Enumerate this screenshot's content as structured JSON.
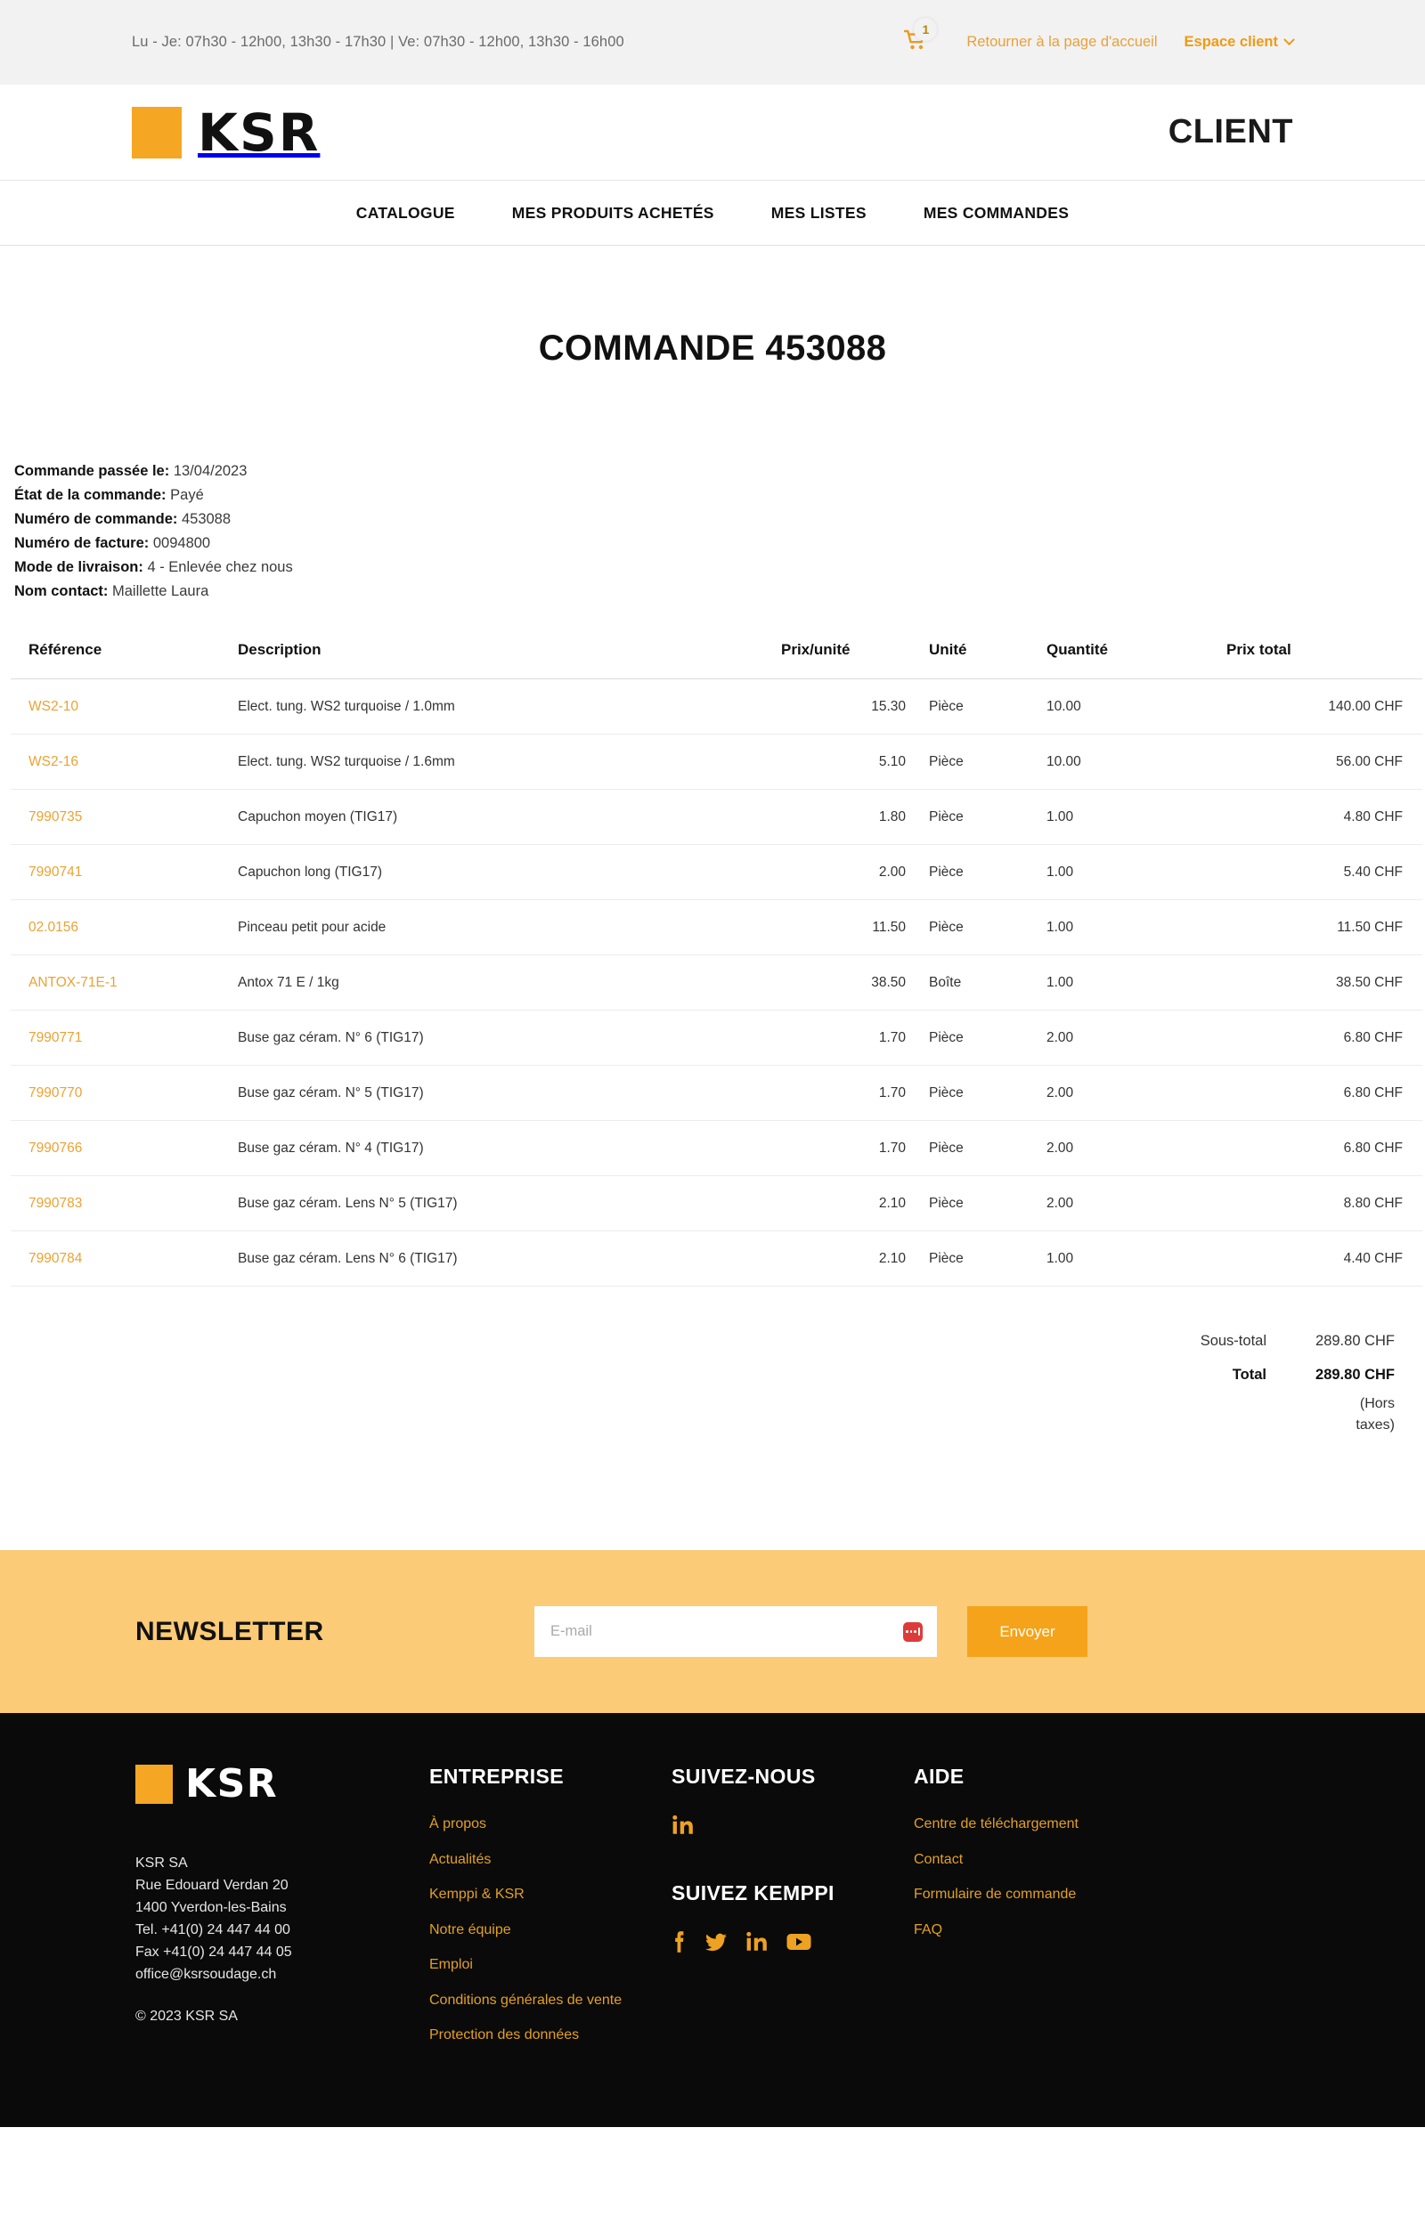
{
  "topbar": {
    "hours": "Lu - Je: 07h30 - 12h00, 13h30 - 17h30 | Ve: 07h30 - 12h00, 13h30 - 16h00",
    "cart_badge": "1",
    "cart_icon": "shopping-cart-icon",
    "home_link": "Retourner à la page d'accueil",
    "account_link": "Espace client"
  },
  "header": {
    "logo_text": "KSR",
    "client_title": "CLIENT"
  },
  "nav": {
    "items": [
      {
        "label": "CATALOGUE"
      },
      {
        "label": "MES PRODUITS ACHETÉS"
      },
      {
        "label": "MES LISTES"
      },
      {
        "label": "MES COMMANDES"
      }
    ]
  },
  "page": {
    "title": "COMMANDE 453088"
  },
  "order_meta": [
    {
      "label": "Commande passée le:",
      "value": "13/04/2023"
    },
    {
      "label": "État de la commande:",
      "value": "Payé"
    },
    {
      "label": "Numéro de commande:",
      "value": "453088"
    },
    {
      "label": "Numéro de facture:",
      "value": "0094800"
    },
    {
      "label": "Mode de livraison:",
      "value": "4 - Enlevée chez nous"
    },
    {
      "label": "Nom contact:",
      "value": "Maillette Laura"
    }
  ],
  "table": {
    "columns": [
      "Référence",
      "Description",
      "Prix/unité",
      "Unité",
      "Quantité",
      "Prix total"
    ],
    "rows": [
      {
        "ref": "WS2-10",
        "desc": "Elect. tung. WS2 turquoise / 1.0mm",
        "price": "15.30",
        "unit": "Pièce",
        "qty": "10.00",
        "total": "140.00 CHF"
      },
      {
        "ref": "WS2-16",
        "desc": "Elect. tung. WS2 turquoise / 1.6mm",
        "price": "5.10",
        "unit": "Pièce",
        "qty": "10.00",
        "total": "56.00 CHF"
      },
      {
        "ref": "7990735",
        "desc": "Capuchon moyen (TIG17)",
        "price": "1.80",
        "unit": "Pièce",
        "qty": "1.00",
        "total": "4.80 CHF"
      },
      {
        "ref": "7990741",
        "desc": "Capuchon long (TIG17)",
        "price": "2.00",
        "unit": "Pièce",
        "qty": "1.00",
        "total": "5.40 CHF"
      },
      {
        "ref": "02.0156",
        "desc": "Pinceau petit pour acide",
        "price": "11.50",
        "unit": "Pièce",
        "qty": "1.00",
        "total": "11.50 CHF"
      },
      {
        "ref": "ANTOX-71E-1",
        "desc": "Antox 71 E / 1kg",
        "price": "38.50",
        "unit": "Boîte",
        "qty": "1.00",
        "total": "38.50 CHF"
      },
      {
        "ref": "7990771",
        "desc": "Buse gaz céram. N° 6 (TIG17)",
        "price": "1.70",
        "unit": "Pièce",
        "qty": "2.00",
        "total": "6.80 CHF"
      },
      {
        "ref": "7990770",
        "desc": "Buse gaz céram. N° 5 (TIG17)",
        "price": "1.70",
        "unit": "Pièce",
        "qty": "2.00",
        "total": "6.80 CHF"
      },
      {
        "ref": "7990766",
        "desc": "Buse gaz céram. N° 4 (TIG17)",
        "price": "1.70",
        "unit": "Pièce",
        "qty": "2.00",
        "total": "6.80 CHF"
      },
      {
        "ref": "7990783",
        "desc": "Buse gaz céram. Lens N° 5 (TIG17)",
        "price": "2.10",
        "unit": "Pièce",
        "qty": "2.00",
        "total": "8.80 CHF"
      },
      {
        "ref": "7990784",
        "desc": "Buse gaz céram. Lens N° 6 (TIG17)",
        "price": "2.10",
        "unit": "Pièce",
        "qty": "1.00",
        "total": "4.40 CHF"
      }
    ]
  },
  "totals": {
    "subtotal_label": "Sous-total",
    "subtotal_value": "289.80 CHF",
    "total_label": "Total",
    "total_value": "289.80 CHF",
    "note": "(Hors taxes)"
  },
  "newsletter": {
    "title": "NEWSLETTER",
    "placeholder": "E-mail",
    "value": "",
    "password_manager_icon": "password-manager-icon",
    "submit_label": "Envoyer"
  },
  "footer": {
    "logo_text": "KSR",
    "address": "KSR SA\nRue Edouard Verdan 20\n1400 Yverdon-les-Bains\nTel. +41(0) 24 447 44 00\nFax +41(0) 24 447 44 05\noffice@ksrsoudage.ch",
    "copyright": "© 2023 KSR SA",
    "company": {
      "heading": "ENTREPRISE",
      "links": [
        "À propos",
        "Actualités",
        "Kemppi & KSR",
        "Notre équipe",
        "Emploi",
        "Conditions générales de vente",
        "Protection des données"
      ]
    },
    "follow": {
      "heading": "SUIVEZ-NOUS",
      "socials": [
        "linkedin-icon"
      ]
    },
    "follow_kemppi": {
      "heading": "SUIVEZ KEMPPI",
      "socials": [
        "facebook-icon",
        "twitter-icon",
        "linkedin-icon",
        "youtube-icon"
      ]
    },
    "help": {
      "heading": "AIDE",
      "links": [
        "Centre de téléchargement",
        "Contact",
        "Formulaire de commande",
        "FAQ"
      ]
    }
  },
  "colors": {
    "brand_orange": "#f5a623",
    "link_orange": "#e2a023",
    "newsletter_bg": "#fbcb77",
    "topbar_bg": "#f2f2f2",
    "footer_bg": "#0a0a0a"
  }
}
